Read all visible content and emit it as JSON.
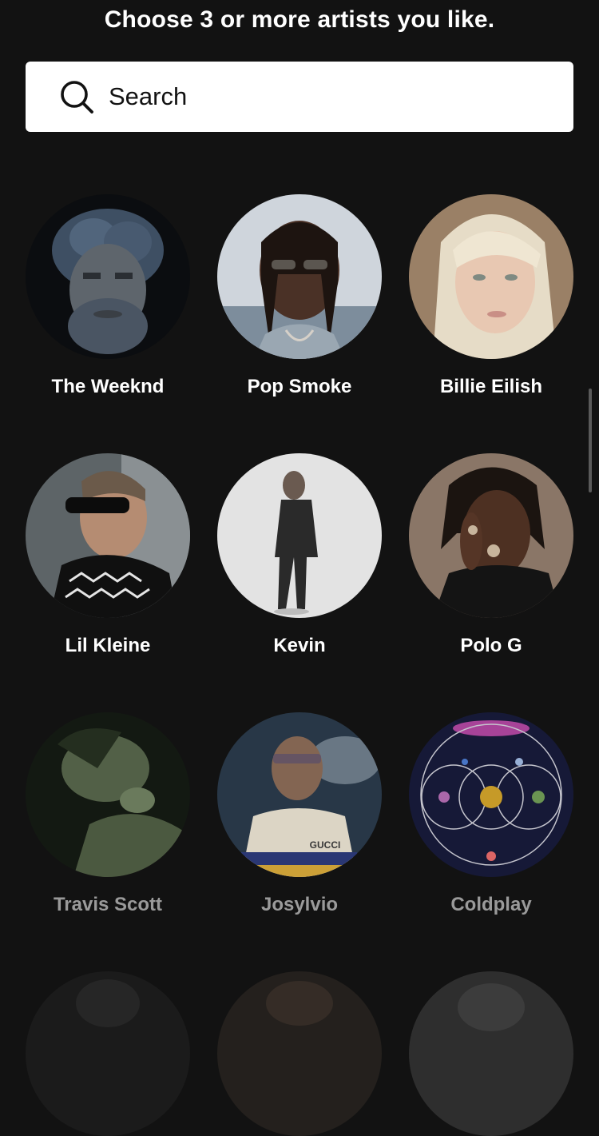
{
  "header": {
    "title": "Choose 3 or more artists you like."
  },
  "search": {
    "placeholder": "Search",
    "icon": "search-icon"
  },
  "artists": [
    {
      "name": "The Weeknd",
      "selected_state": "normal"
    },
    {
      "name": "Pop Smoke",
      "selected_state": "normal"
    },
    {
      "name": "Billie Eilish",
      "selected_state": "normal"
    },
    {
      "name": "Lil Kleine",
      "selected_state": "normal"
    },
    {
      "name": "Kevin",
      "selected_state": "normal"
    },
    {
      "name": "Polo G",
      "selected_state": "normal"
    },
    {
      "name": "Travis Scott",
      "selected_state": "dimmed"
    },
    {
      "name": "Josylvio",
      "selected_state": "dimmed"
    },
    {
      "name": "Coldplay",
      "selected_state": "dimmed"
    }
  ],
  "colors": {
    "background": "#121212",
    "search_bg": "#ffffff",
    "text": "#ffffff",
    "dim_text": "#9a9a9a"
  }
}
